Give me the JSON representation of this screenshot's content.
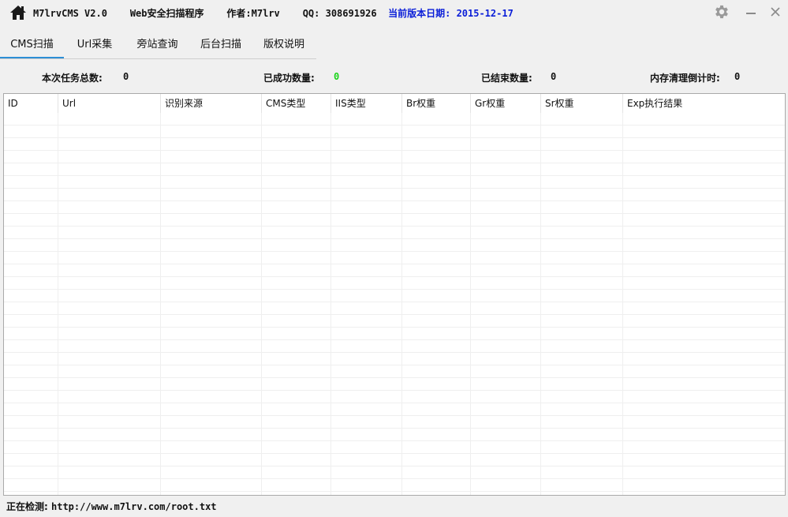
{
  "window": {
    "title_segments": {
      "app_name": "M7lrvCMS V2.0",
      "app_desc": "Web安全扫描程序",
      "author_label": "作者:",
      "author_value": "M7lrv",
      "qq_label": "QQ:",
      "qq_value": "308691926",
      "date_label": "当前版本日期:",
      "date_value": "2015-12-17"
    },
    "accent_color": "#0a1ed8",
    "icons": [
      "home-icon",
      "gear-icon",
      "minimize-icon",
      "close-icon"
    ]
  },
  "tabs": [
    {
      "label": "CMS扫描",
      "active": true
    },
    {
      "label": "Url采集",
      "active": false
    },
    {
      "label": "旁站查询",
      "active": false
    },
    {
      "label": "后台扫描",
      "active": false
    },
    {
      "label": "版权说明",
      "active": false
    }
  ],
  "stats": {
    "total_label": "本次任务总数:",
    "total_value": "0",
    "success_label": "已成功数量:",
    "success_value": "0",
    "finished_label": "已结束数量:",
    "finished_value": "0",
    "memclean_label": "内存清理倒计时:",
    "memclean_value": "0",
    "success_color": "#1ad41a"
  },
  "table": {
    "columns": [
      "ID",
      "Url",
      "识别来源",
      "CMS类型",
      "IIS类型",
      "Br权重",
      "Gr权重",
      "Sr权重",
      "Exp执行结果"
    ],
    "rows": []
  },
  "status": {
    "label": "正在检测:",
    "value": "http://www.m7lrv.com/root.txt"
  }
}
